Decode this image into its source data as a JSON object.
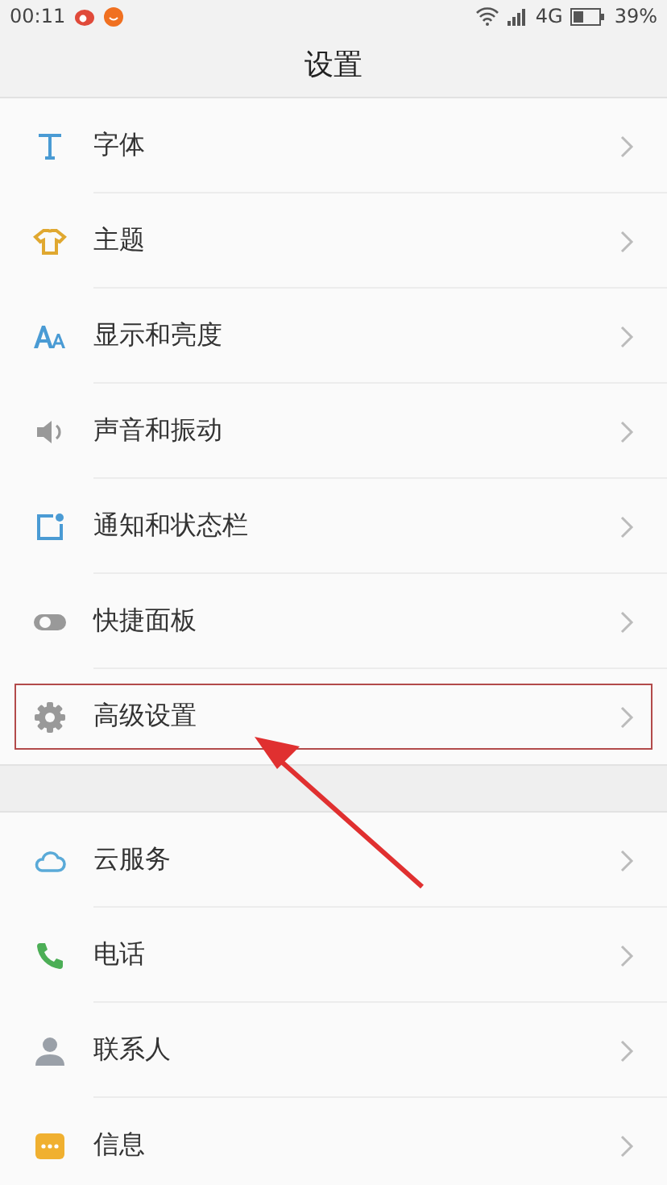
{
  "status_bar": {
    "time": "00:11",
    "network": "4G",
    "battery": "39%"
  },
  "title": "设置",
  "sections": [
    {
      "items": [
        {
          "label": "字体",
          "highlighted": false
        },
        {
          "label": "主题",
          "highlighted": false
        },
        {
          "label": "显示和亮度",
          "highlighted": false
        },
        {
          "label": "声音和振动",
          "highlighted": false
        },
        {
          "label": "通知和状态栏",
          "highlighted": false
        },
        {
          "label": "快捷面板",
          "highlighted": false
        },
        {
          "label": "高级设置",
          "highlighted": true
        }
      ]
    },
    {
      "items": [
        {
          "label": "云服务",
          "highlighted": false
        },
        {
          "label": "电话",
          "highlighted": false
        },
        {
          "label": "联系人",
          "highlighted": false
        },
        {
          "label": "信息",
          "highlighted": false
        }
      ]
    }
  ]
}
